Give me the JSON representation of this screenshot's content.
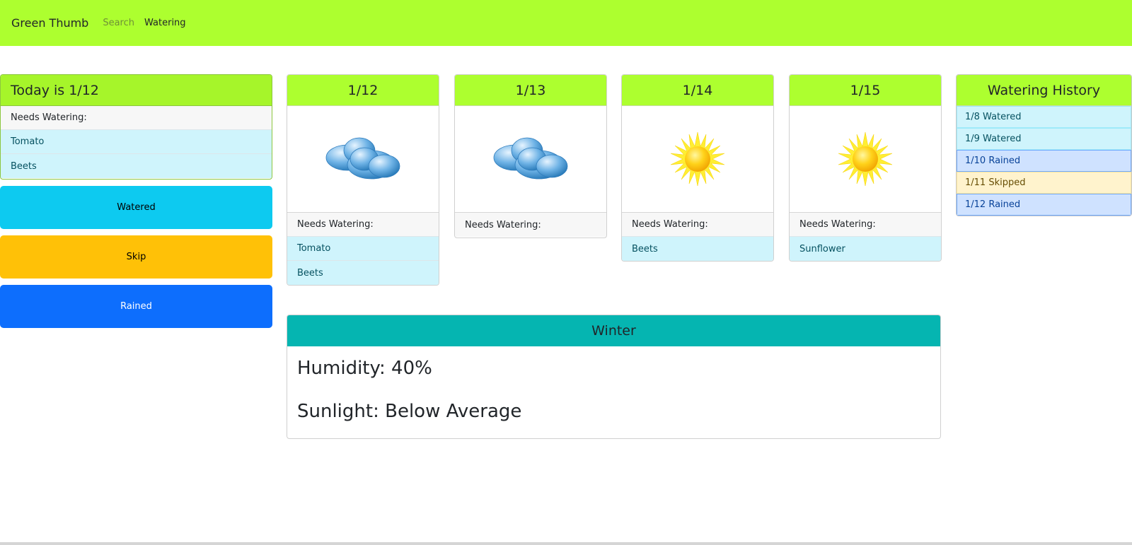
{
  "nav": {
    "brand": "Green Thumb",
    "links": [
      "Search",
      "Watering"
    ]
  },
  "today": {
    "title": "Today is 1/12",
    "needs_label": "Needs Watering:",
    "plants": [
      "Tomato",
      "Beets"
    ]
  },
  "actions": {
    "watered": "Watered",
    "skip": "Skip",
    "rained": "Rained"
  },
  "forecast": [
    {
      "date": "1/12",
      "weather_icon": "cloud-icon",
      "needs_label": "Needs Watering:",
      "plants": [
        "Tomato",
        "Beets"
      ]
    },
    {
      "date": "1/13",
      "weather_icon": "cloud-icon",
      "needs_label": "Needs Watering:",
      "plants": []
    },
    {
      "date": "1/14",
      "weather_icon": "sun-icon",
      "needs_label": "Needs Watering:",
      "plants": [
        "Beets"
      ]
    },
    {
      "date": "1/15",
      "weather_icon": "sun-icon",
      "needs_label": "Needs Watering:",
      "plants": [
        "Sunflower"
      ]
    }
  ],
  "history": {
    "title": "Watering History",
    "items": [
      "1/8 Watered",
      "1/9 Watered",
      "1/10 Rained",
      "1/11 Skipped",
      "1/12 Rained"
    ]
  },
  "season": {
    "title": "Winter",
    "humidity": "Humidity: 40%",
    "sunlight": "Sunlight: Below Average"
  },
  "colors": {
    "navbar": "#adff2f",
    "header": "#adff2f",
    "season_header": "#05b5b1",
    "watered": "#0dcaf0",
    "skip": "#ffc107",
    "rained": "#0d6efd"
  }
}
